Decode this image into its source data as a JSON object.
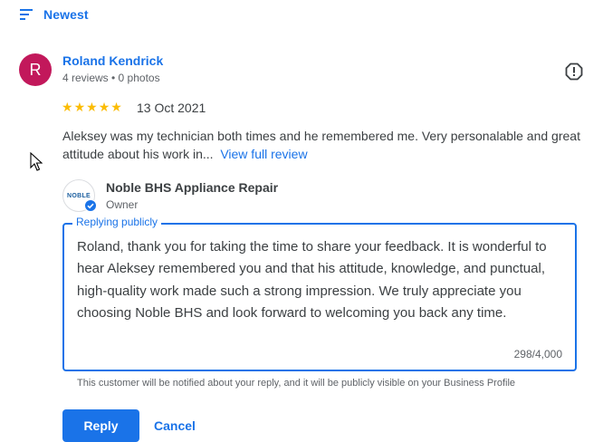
{
  "sort": {
    "label": "Newest",
    "icon": "sort-icon"
  },
  "review": {
    "avatar_letter": "R",
    "avatar_color": "#c2185b",
    "reviewer_name": "Roland Kendrick",
    "reviewer_meta": "4 reviews • 0 photos",
    "rating": 5,
    "date": "13 Oct 2021",
    "text": "Aleksey was my technician both times and he remembered me. Very personalable and great attitude about his work in...",
    "view_full_label": "View full review"
  },
  "owner": {
    "logo_text": "NOBLE",
    "name": "Noble BHS Appliance Repair",
    "role": "Owner"
  },
  "reply": {
    "legend": "Replying publicly",
    "text": "Roland, thank you for taking the time to share your feedback. It is wonderful to hear Aleksey remembered you and that his attitude, knowledge, and punctual, high-quality work made such a strong impression. We truly appreciate you choosing Noble BHS and look forward to welcoming you back any time.",
    "char_count": "298/4,000",
    "notice": "This customer will be notified about your reply, and it will be publicly visible on your Business Profile"
  },
  "buttons": {
    "reply_label": "Reply",
    "cancel_label": "Cancel"
  },
  "colors": {
    "accent": "#1a73e8",
    "star": "#fbbc04"
  }
}
